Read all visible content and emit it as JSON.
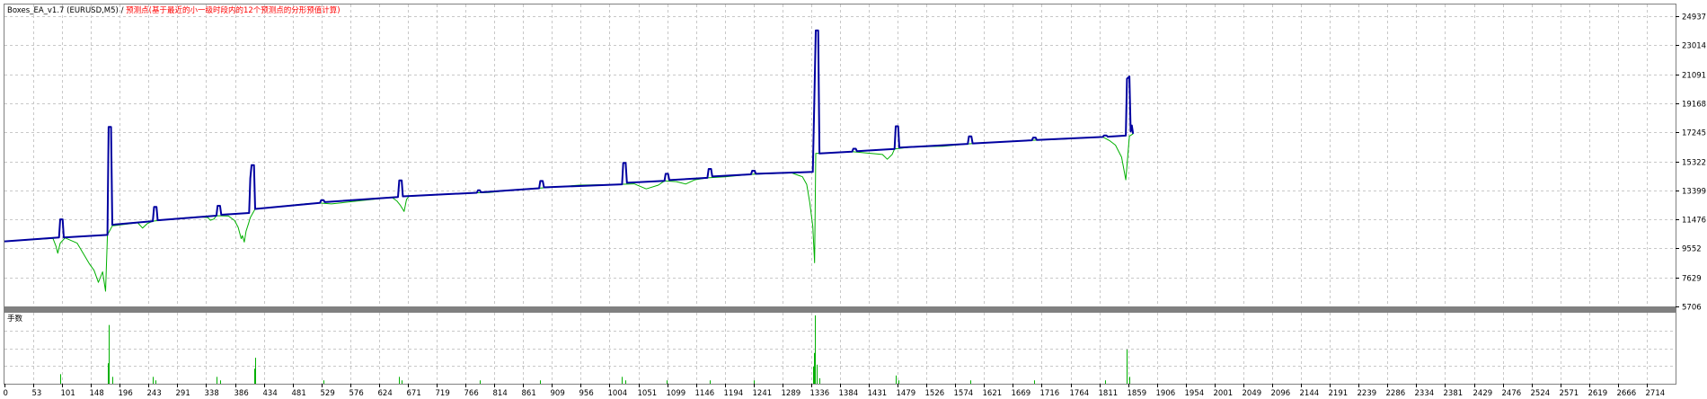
{
  "chart_data": [
    {
      "type": "line",
      "title_part1": "Boxes_EA_v1.7 (EURUSD,M5)",
      "title_separator": " / ",
      "title_part2": "预测点(基于最近的小一级时段内的12个预测点的分形预值计算)",
      "y_ticks": [
        "24937",
        "23014",
        "21091",
        "19168",
        "17245",
        "15322",
        "13399",
        "11476",
        "9552",
        "7629",
        "5706"
      ],
      "ylim": [
        5706,
        25720
      ],
      "xlim": [
        0,
        2760
      ],
      "grid": true,
      "series": [
        {
          "color": "#0000a0",
          "points": [
            [
              0,
              10020
            ],
            [
              90,
              10280
            ],
            [
              92,
              11480
            ],
            [
              96,
              11480
            ],
            [
              98,
              10280
            ],
            [
              170,
              10450
            ],
            [
              172,
              17600
            ],
            [
              176,
              17600
            ],
            [
              178,
              11120
            ],
            [
              245,
              11360
            ],
            [
              247,
              12300
            ],
            [
              251,
              12300
            ],
            [
              253,
              11420
            ],
            [
              350,
              11720
            ],
            [
              352,
              12380
            ],
            [
              356,
              12380
            ],
            [
              358,
              11780
            ],
            [
              404,
              11900
            ],
            [
              406,
              14200
            ],
            [
              408,
              15070
            ],
            [
              412,
              15070
            ],
            [
              414,
              12170
            ],
            [
              521,
              12570
            ],
            [
              523,
              12750
            ],
            [
              527,
              12750
            ],
            [
              529,
              12620
            ],
            [
              650,
              12960
            ],
            [
              652,
              14060
            ],
            [
              656,
              14060
            ],
            [
              658,
              13000
            ],
            [
              780,
              13240
            ],
            [
              782,
              13400
            ],
            [
              785,
              13400
            ],
            [
              787,
              13270
            ],
            [
              883,
              13540
            ],
            [
              885,
              14020
            ],
            [
              889,
              14020
            ],
            [
              891,
              13600
            ],
            [
              1020,
              13800
            ],
            [
              1022,
              15220
            ],
            [
              1026,
              15220
            ],
            [
              1028,
              13900
            ],
            [
              1090,
              14030
            ],
            [
              1092,
              14500
            ],
            [
              1096,
              14500
            ],
            [
              1098,
              14080
            ],
            [
              1161,
              14230
            ],
            [
              1163,
              14820
            ],
            [
              1167,
              14820
            ],
            [
              1169,
              14320
            ],
            [
              1233,
              14460
            ],
            [
              1235,
              14700
            ],
            [
              1239,
              14700
            ],
            [
              1241,
              14500
            ],
            [
              1335,
              14620
            ],
            [
              1337,
              18200
            ],
            [
              1340,
              24000
            ],
            [
              1344,
              24000
            ],
            [
              1346,
              15850
            ],
            [
              1400,
              15970
            ],
            [
              1402,
              16160
            ],
            [
              1406,
              16160
            ],
            [
              1408,
              15990
            ],
            [
              1470,
              16150
            ],
            [
              1472,
              17650
            ],
            [
              1476,
              17650
            ],
            [
              1478,
              16230
            ],
            [
              1591,
              16480
            ],
            [
              1593,
              16980
            ],
            [
              1597,
              16980
            ],
            [
              1599,
              16510
            ],
            [
              1697,
              16720
            ],
            [
              1699,
              16900
            ],
            [
              1703,
              16900
            ],
            [
              1705,
              16740
            ],
            [
              1814,
              16940
            ],
            [
              1816,
              17040
            ],
            [
              1820,
              17040
            ],
            [
              1822,
              16960
            ],
            [
              1852,
              17030
            ],
            [
              1854,
              20800
            ],
            [
              1858,
              20950
            ],
            [
              1860,
              17300
            ],
            [
              1862,
              17700
            ],
            [
              1864,
              17150
            ]
          ]
        },
        {
          "color": "#00b000",
          "points": [
            [
              0,
              10020
            ],
            [
              80,
              10220
            ],
            [
              85,
              9700
            ],
            [
              88,
              9230
            ],
            [
              92,
              9900
            ],
            [
              100,
              10250
            ],
            [
              120,
              9900
            ],
            [
              140,
              8550
            ],
            [
              148,
              8100
            ],
            [
              155,
              7300
            ],
            [
              162,
              8000
            ],
            [
              167,
              6720
            ],
            [
              170,
              10450
            ],
            [
              178,
              11050
            ],
            [
              220,
              11250
            ],
            [
              228,
              10900
            ],
            [
              236,
              11200
            ],
            [
              245,
              11360
            ],
            [
              280,
              11520
            ],
            [
              320,
              11650
            ],
            [
              336,
              11600
            ],
            [
              340,
              11420
            ],
            [
              346,
              11500
            ],
            [
              350,
              11720
            ],
            [
              370,
              11700
            ],
            [
              380,
              11400
            ],
            [
              386,
              10950
            ],
            [
              391,
              10200
            ],
            [
              393,
              10400
            ],
            [
              396,
              9970
            ],
            [
              399,
              10700
            ],
            [
              403,
              11200
            ],
            [
              406,
              11600
            ],
            [
              414,
              12170
            ],
            [
              500,
              12520
            ],
            [
              520,
              12560
            ],
            [
              540,
              12500
            ],
            [
              580,
              12680
            ],
            [
              640,
              12940
            ],
            [
              648,
              12700
            ],
            [
              654,
              12400
            ],
            [
              660,
              12000
            ],
            [
              664,
              12800
            ],
            [
              668,
              13000
            ],
            [
              760,
              13200
            ],
            [
              780,
              13240
            ],
            [
              800,
              13260
            ],
            [
              830,
              13380
            ],
            [
              860,
              13500
            ],
            [
              880,
              13540
            ],
            [
              910,
              13620
            ],
            [
              950,
              13750
            ],
            [
              1010,
              13790
            ],
            [
              1040,
              13830
            ],
            [
              1060,
              13500
            ],
            [
              1080,
              13750
            ],
            [
              1090,
              14030
            ],
            [
              1110,
              13980
            ],
            [
              1125,
              13820
            ],
            [
              1140,
              14100
            ],
            [
              1161,
              14230
            ],
            [
              1190,
              14300
            ],
            [
              1233,
              14460
            ],
            [
              1260,
              14500
            ],
            [
              1300,
              14560
            ],
            [
              1318,
              14300
            ],
            [
              1325,
              13800
            ],
            [
              1330,
              12600
            ],
            [
              1335,
              11000
            ],
            [
              1338,
              8600
            ],
            [
              1340,
              15850
            ],
            [
              1400,
              15970
            ],
            [
              1450,
              15780
            ],
            [
              1458,
              15460
            ],
            [
              1466,
              15780
            ],
            [
              1470,
              16150
            ],
            [
              1500,
              16280
            ],
            [
              1550,
              16320
            ],
            [
              1591,
              16480
            ],
            [
              1620,
              16550
            ],
            [
              1697,
              16720
            ],
            [
              1750,
              16800
            ],
            [
              1814,
              16940
            ],
            [
              1825,
              16700
            ],
            [
              1835,
              16400
            ],
            [
              1845,
              15600
            ],
            [
              1852,
              14100
            ],
            [
              1858,
              17000
            ],
            [
              1864,
              17150
            ]
          ]
        }
      ]
    },
    {
      "type": "bar",
      "title": "手数",
      "x_ticks": [
        "0",
        "53",
        "101",
        "148",
        "196",
        "243",
        "291",
        "338",
        "386",
        "434",
        "481",
        "529",
        "576",
        "624",
        "671",
        "719",
        "766",
        "814",
        "861",
        "909",
        "956",
        "1004",
        "1051",
        "1099",
        "1146",
        "1194",
        "1241",
        "1289",
        "1336",
        "1384",
        "1431",
        "1479",
        "1526",
        "1574",
        "1621",
        "1669",
        "1716",
        "1764",
        "1811",
        "1859",
        "1906",
        "1954",
        "2001",
        "2049",
        "2096",
        "2144",
        "2191",
        "2239",
        "2286",
        "2334",
        "2381",
        "2429",
        "2476",
        "2524",
        "2571",
        "2619",
        "2666",
        "2714"
      ],
      "xlim": [
        0,
        2760
      ],
      "ylim": [
        0,
        1
      ],
      "grid": true,
      "bar_color": "#00b000",
      "bars": [
        [
          92,
          0.14
        ],
        [
          170,
          0.3
        ],
        [
          172,
          0.86
        ],
        [
          178,
          0.1
        ],
        [
          245,
          0.1
        ],
        [
          250,
          0.05
        ],
        [
          350,
          0.1
        ],
        [
          356,
          0.05
        ],
        [
          412,
          0.22
        ],
        [
          414,
          0.38
        ],
        [
          527,
          0.05
        ],
        [
          652,
          0.1
        ],
        [
          656,
          0.05
        ],
        [
          785,
          0.05
        ],
        [
          885,
          0.05
        ],
        [
          1020,
          0.1
        ],
        [
          1025,
          0.05
        ],
        [
          1094,
          0.05
        ],
        [
          1165,
          0.05
        ],
        [
          1237,
          0.05
        ],
        [
          1335,
          0.25
        ],
        [
          1337,
          0.45
        ],
        [
          1339,
          1.0
        ],
        [
          1342,
          0.28
        ],
        [
          1346,
          0.08
        ],
        [
          1472,
          0.12
        ],
        [
          1476,
          0.05
        ],
        [
          1595,
          0.05
        ],
        [
          1701,
          0.05
        ],
        [
          1818,
          0.05
        ],
        [
          1854,
          0.5
        ],
        [
          1858,
          0.1
        ]
      ]
    }
  ]
}
